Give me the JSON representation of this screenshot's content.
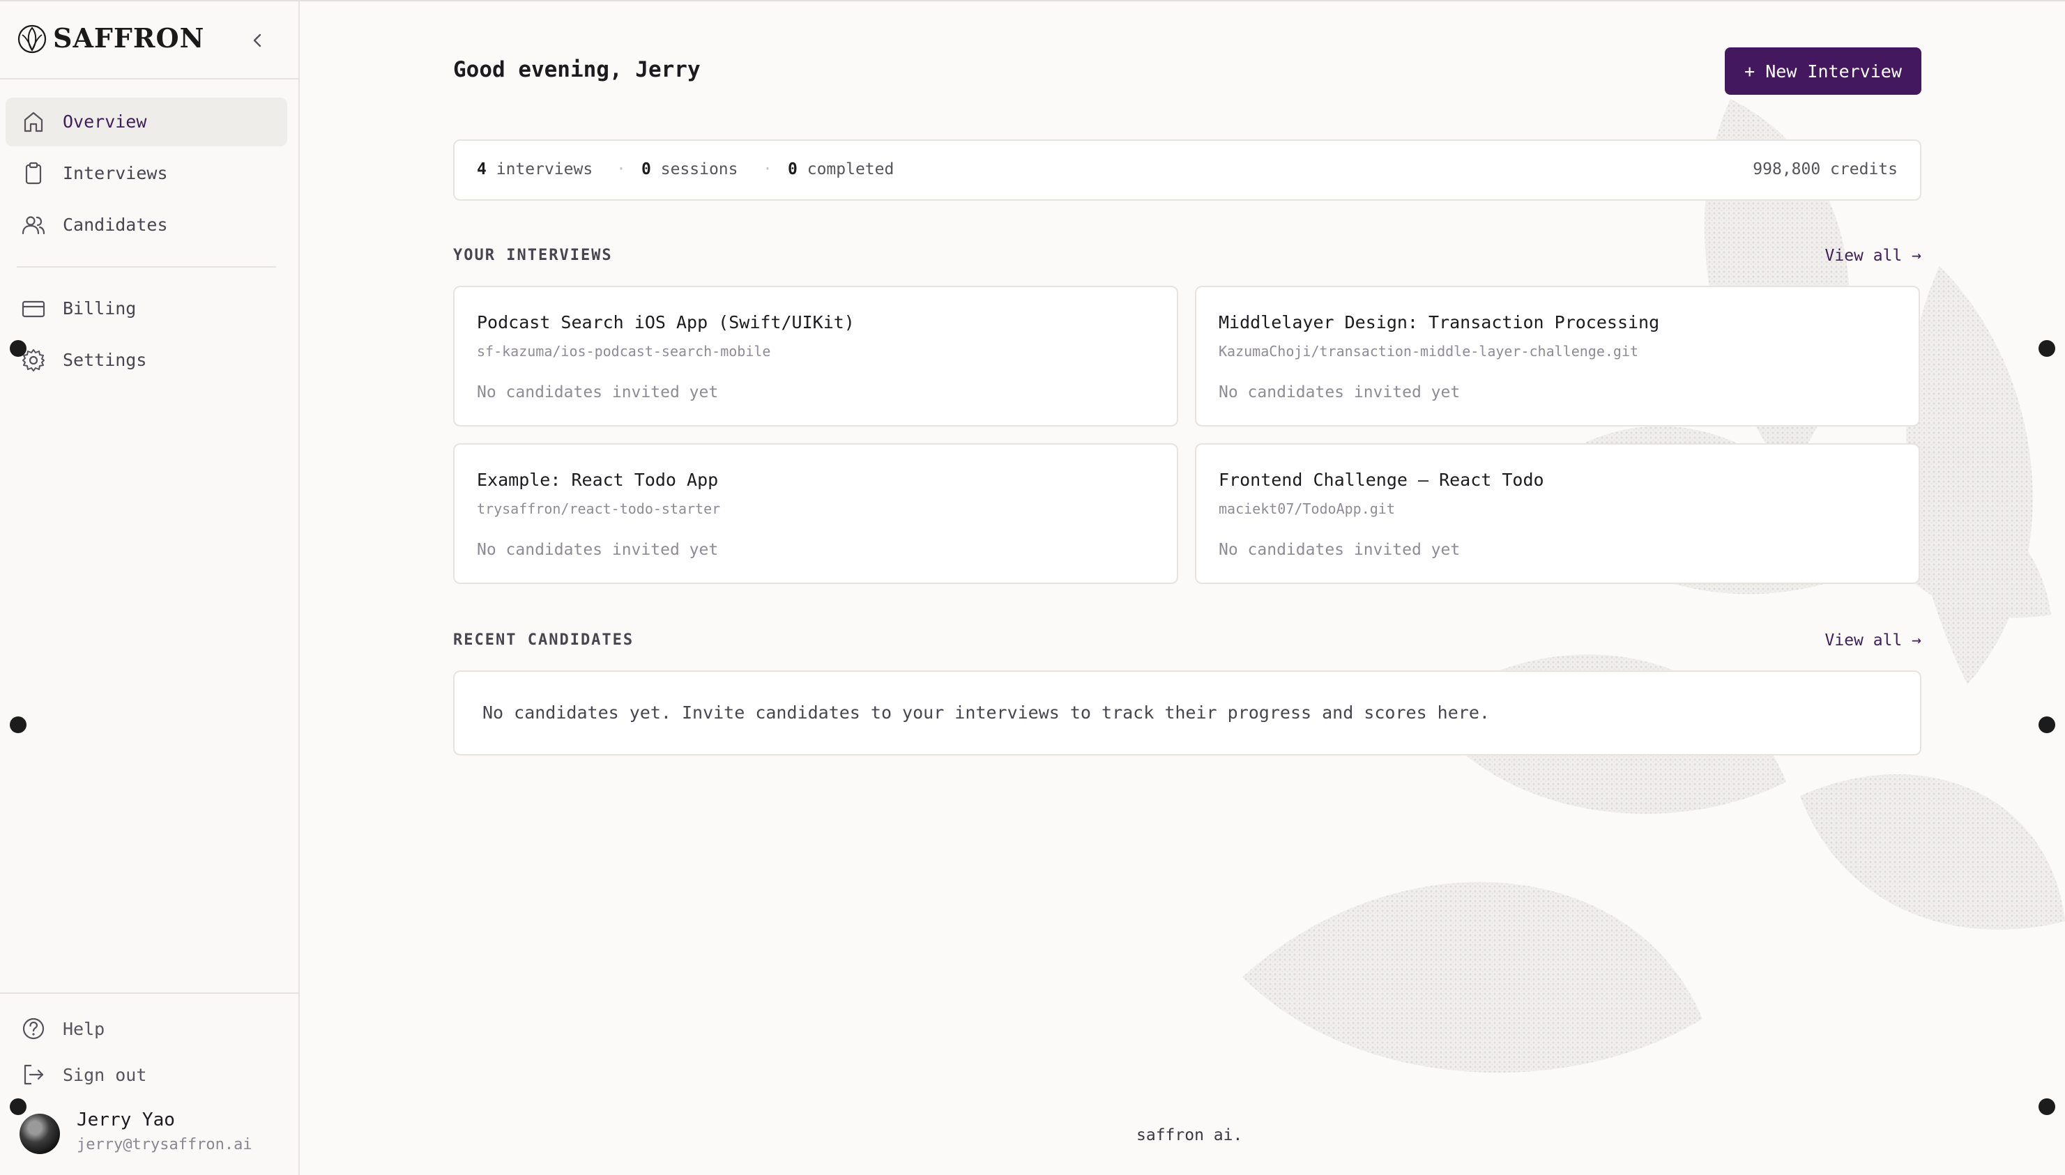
{
  "brand": {
    "name": "SAFFRON"
  },
  "sidebar": {
    "nav": [
      {
        "label": "Overview",
        "icon": "home-icon",
        "active": true
      },
      {
        "label": "Interviews",
        "icon": "clipboard-icon"
      },
      {
        "label": "Candidates",
        "icon": "users-icon"
      }
    ],
    "nav2": [
      {
        "label": "Billing",
        "icon": "credit-card-icon"
      },
      {
        "label": "Settings",
        "icon": "gear-icon"
      }
    ],
    "bottom": [
      {
        "label": "Help",
        "icon": "help-circle-icon"
      },
      {
        "label": "Sign out",
        "icon": "sign-out-icon"
      }
    ],
    "user": {
      "name": "Jerry Yao",
      "email": "jerry@trysaffron.ai"
    }
  },
  "header": {
    "greeting": "Good evening, Jerry",
    "new_button": "+ New Interview"
  },
  "stats": {
    "interviews_count": "4",
    "interviews_label": "interviews",
    "sessions_count": "0",
    "sessions_label": "sessions",
    "completed_count": "0",
    "completed_label": "completed",
    "separator": "·",
    "credits": "998,800 credits"
  },
  "interviews_section": {
    "title": "YOUR INTERVIEWS",
    "view_all": "View all →",
    "cards": [
      {
        "title": "Podcast Search iOS App (Swift/UIKit)",
        "repo": "sf-kazuma/ios-podcast-search-mobile",
        "status": "No candidates invited yet"
      },
      {
        "title": "Middlelayer Design: Transaction Processing",
        "repo": "KazumaChoji/transaction-middle-layer-challenge.git",
        "status": "No candidates invited yet"
      },
      {
        "title": "Example: React Todo App",
        "repo": "trysaffron/react-todo-starter",
        "status": "No candidates invited yet"
      },
      {
        "title": "Frontend Challenge — React Todo",
        "repo": "maciekt07/TodoApp.git",
        "status": "No candidates invited yet"
      }
    ]
  },
  "candidates_section": {
    "title": "RECENT CANDIDATES",
    "view_all": "View all →",
    "empty_message": "No candidates yet. Invite candidates to your interviews to track their progress and scores here."
  },
  "footer": {
    "brand": "saffron ai."
  },
  "colors": {
    "accent": "#43185f",
    "background": "#fbfaf9",
    "border": "#e7e4e0"
  }
}
